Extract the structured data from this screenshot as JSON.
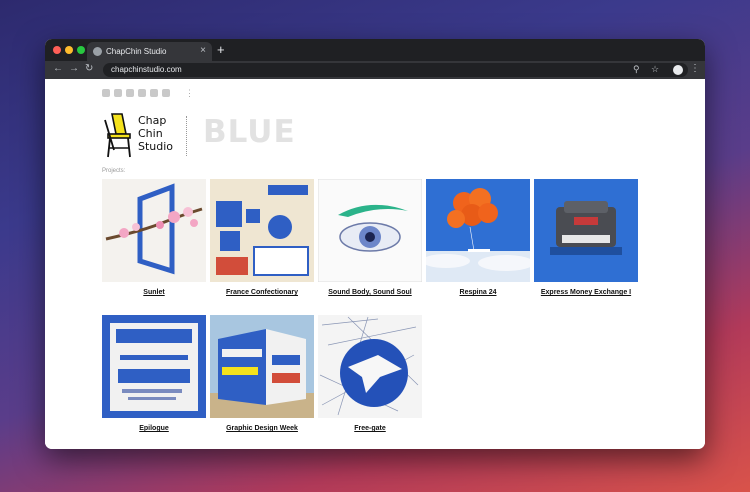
{
  "browser": {
    "tab_title": "ChapChin Studio",
    "new_tab": "+",
    "tab_close": "×",
    "url": "chapchinstudio.com"
  },
  "site": {
    "logo_line1": "Chap",
    "logo_line2": "Chin",
    "logo_line3": "Studio",
    "heading": "BLUE",
    "projects_label": "Projects:",
    "social_icons": [
      "phone-icon",
      "vimeo-icon",
      "facebook-icon",
      "behance-icon",
      "instagram-icon",
      "mail-icon"
    ]
  },
  "projects": [
    {
      "name": "Sunlet"
    },
    {
      "name": "France Confectionary"
    },
    {
      "name": "Sound Body, Sound Soul"
    },
    {
      "name": "Respina 24"
    },
    {
      "name": "Express Money Exchange I"
    },
    {
      "name": "Epilogue"
    },
    {
      "name": "Graphic Design Week"
    },
    {
      "name": "Free-gate"
    }
  ],
  "colors": {
    "accent_blue": "#2f5fc4",
    "logo_yellow": "#f4e21d",
    "heading_grey": "#e2e2e2"
  }
}
